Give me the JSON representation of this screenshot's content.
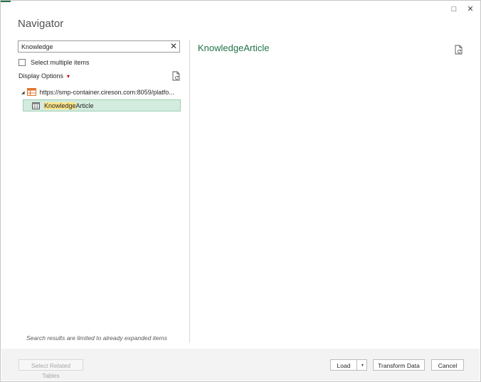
{
  "dialog": {
    "title": "Navigator",
    "window_controls": {
      "restore_icon": "□",
      "close_icon": "✕"
    }
  },
  "search": {
    "value": "Knowledge",
    "placeholder": "",
    "clear_icon": "✕"
  },
  "select_multiple": {
    "label": "Select multiple items",
    "checked": false
  },
  "display_options": {
    "label": "Display Options",
    "caret": "▾"
  },
  "tree": {
    "server": {
      "label": "https://smp-container.cireson.com:8059/platfo...",
      "expander": "◢"
    },
    "items": [
      {
        "highlight": "Knowledge",
        "rest": "Article",
        "selected": true
      }
    ]
  },
  "preview": {
    "title": "KnowledgeArticle"
  },
  "note": "Search results are limited to already expanded items",
  "footer": {
    "select_related": "Select Related Tables",
    "load": "Load",
    "load_dropdown": "▾",
    "transform": "Transform Data",
    "cancel": "Cancel"
  },
  "colors": {
    "accent": "#217346",
    "selected_bg": "#d3ecdf",
    "search_highlight": "#fde58a",
    "caret_red": "#c00000"
  }
}
